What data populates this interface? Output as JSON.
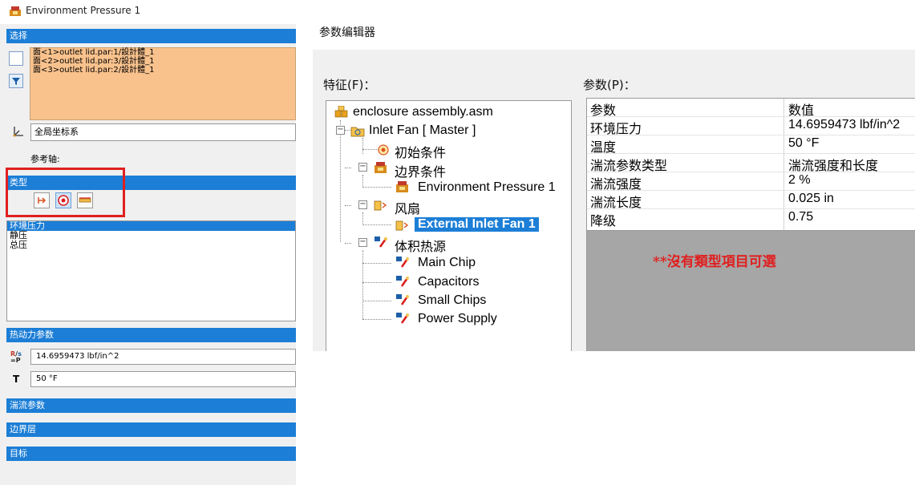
{
  "window": {
    "title": "Environment Pressure 1"
  },
  "selection": {
    "header": "选择",
    "faces": [
      "面<1>outlet lid.par:1/設計體_1",
      "面<2>outlet lid.par:3/設計體_1",
      "面<3>outlet lid.par:2/設計體_1"
    ],
    "coord_system": "全局坐标系",
    "ref_axis_label": "参考轴:"
  },
  "type": {
    "header": "类型",
    "options": [
      "环境压力",
      "静压",
      "总压"
    ],
    "selected": "环境压力"
  },
  "thermo": {
    "header": "热动力参数",
    "pressure": "14.6959473 lbf/in^2",
    "temp_label": "T",
    "temperature": "50 °F"
  },
  "collapsed_sections": [
    "湍流参数",
    "边界层",
    "目标"
  ],
  "param_editor": {
    "title": "参数编辑器",
    "features_label": "特征(F)：",
    "params_label": "参数(P)：",
    "tree": {
      "root": "enclosure assembly.asm",
      "fan_master": "Inlet Fan [ Master ]",
      "initial_conditions": "初始条件",
      "boundary_conditions": "边界条件",
      "env_pressure": "Environment Pressure 1",
      "fans": "风扇",
      "ext_fan": "External Inlet Fan 1",
      "heat_sources": "体积热源",
      "sources": [
        "Main Chip",
        "Capacitors",
        "Small Chips",
        "Power Supply"
      ]
    },
    "table": {
      "col_param": "参数",
      "col_value": "数值",
      "rows": [
        {
          "name": "环境压力",
          "value": "14.6959473 lbf/in^2"
        },
        {
          "name": "温度",
          "value": "50 °F"
        },
        {
          "name": "湍流参数类型",
          "value": "湍流强度和长度"
        },
        {
          "name": "湍流强度",
          "value": "2 %"
        },
        {
          "name": "湍流长度",
          "value": "0.025 in"
        },
        {
          "name": "降级",
          "value": "0.75"
        }
      ]
    },
    "note": "**沒有類型項目可選"
  },
  "colors": {
    "section_header": "#1c7ed6",
    "selection_fill": "#f9c28d",
    "highlight_rect": "#e02020",
    "note_text": "#e02020",
    "gray_area": "#a6a6a6"
  }
}
